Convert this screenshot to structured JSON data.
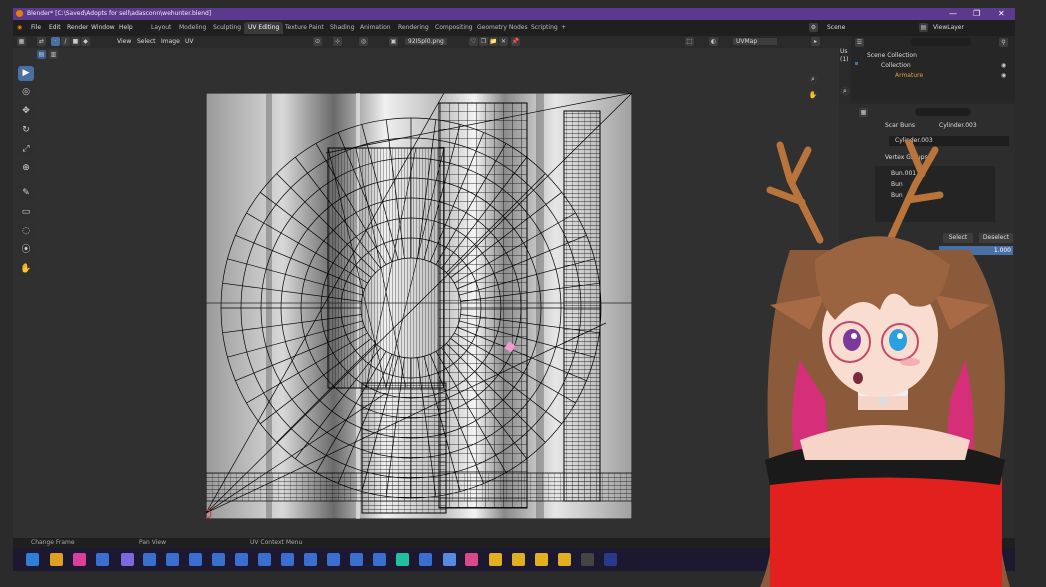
{
  "window": {
    "title": "Blender* [C:\\Saved\\Adopts for sell\\adasconn\\wehunter.blend]",
    "controls": [
      "—",
      "❐",
      "✕"
    ]
  },
  "menu": [
    "File",
    "Edit",
    "Render",
    "Window",
    "Help"
  ],
  "workspaces": [
    "Layout",
    "Modeling",
    "Sculpting",
    "UV Editing",
    "Texture Paint",
    "Shading",
    "Animation",
    "Rendering",
    "Compositing",
    "Geometry Nodes",
    "Scripting",
    "+"
  ],
  "active_workspace": "UV Editing",
  "scene_label": "Scene",
  "viewlayer_label": "ViewLayer",
  "uv_header": {
    "menus": [
      "View",
      "Select",
      "Image",
      "UV"
    ],
    "image_name": "92ISpl0.png",
    "uvmap": "UVMap"
  },
  "tools": [
    "select-tool",
    "cursor-tool",
    "move-tool",
    "rotate-tool",
    "scale-tool",
    "transform-tool",
    "annotate-tool",
    "grab-tool",
    "relax-tool",
    "pinch-tool",
    "rip-tool"
  ],
  "tool_glyphs": [
    "▶",
    "◎",
    "✥",
    "↻",
    "⤢",
    "⊕",
    "✎",
    "▭",
    "◌",
    "⦿",
    "✋"
  ],
  "outliner": {
    "root": "Scene Collection",
    "collection": "Collection",
    "armature": "Armature"
  },
  "properties": {
    "object": "Scar Buns",
    "mesh": "Cylinder.003",
    "data": "Cylinder.003",
    "panel_title": "Vertex Groups",
    "groups": [
      "Bun.001",
      "Bun",
      "Bun"
    ],
    "buttons": [
      "Select",
      "Deselect"
    ],
    "weight": "1.000"
  },
  "viewport_gizmo": [
    "Us",
    "(1)"
  ],
  "status": [
    "Change Frame",
    "Pan View",
    "UV Context Menu"
  ],
  "colors": {
    "title_bar": "#5b3a8e",
    "active_tool": "#4a6fa5",
    "uv_bg": "#303030"
  }
}
